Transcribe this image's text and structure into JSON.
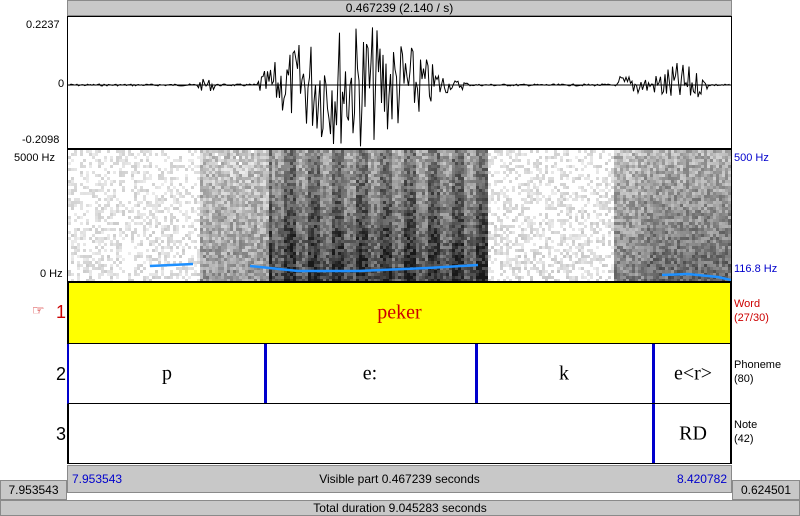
{
  "top_bar": {
    "text": "0.467239 (2.140 / s)"
  },
  "waveform": {
    "max_label": "0.2237",
    "zero_label": "0",
    "min_label": "-0.2098"
  },
  "spectrogram": {
    "top_freq_label": "5000 Hz",
    "bottom_freq_label": "0 Hz",
    "right_top_label": "500 Hz",
    "right_bottom_label": "116.8 Hz"
  },
  "tiers": [
    {
      "number": "1",
      "name": "Word",
      "count": "(27/30)",
      "selected": true,
      "intervals": [
        {
          "text": "peker"
        }
      ]
    },
    {
      "number": "2",
      "name": "Phoneme",
      "count": "(80)",
      "intervals": [
        {
          "text": "p"
        },
        {
          "text": "e:"
        },
        {
          "text": "k"
        },
        {
          "text": "e<r>"
        }
      ]
    },
    {
      "number": "3",
      "name": "Note",
      "count": "(42)",
      "intervals": [
        {
          "text": ""
        },
        {
          "text": "RD"
        }
      ]
    }
  ],
  "pointer_icon": "pointing-hand-icon",
  "visible_bar": {
    "left_time": "7.953543",
    "center_text": "Visible part 0.467239 seconds",
    "right_time": "8.420782"
  },
  "bottom_row": {
    "left_time": "7.953543",
    "right_time": "0.624501"
  },
  "total_bar": {
    "text": "Total duration 9.045283 seconds"
  },
  "colors": {
    "selected_tier": "#ffff00",
    "boundary": "#0000cc",
    "pitch": "#1e90ff",
    "label_red": "#cc0000",
    "label_blue": "#0000cc"
  }
}
